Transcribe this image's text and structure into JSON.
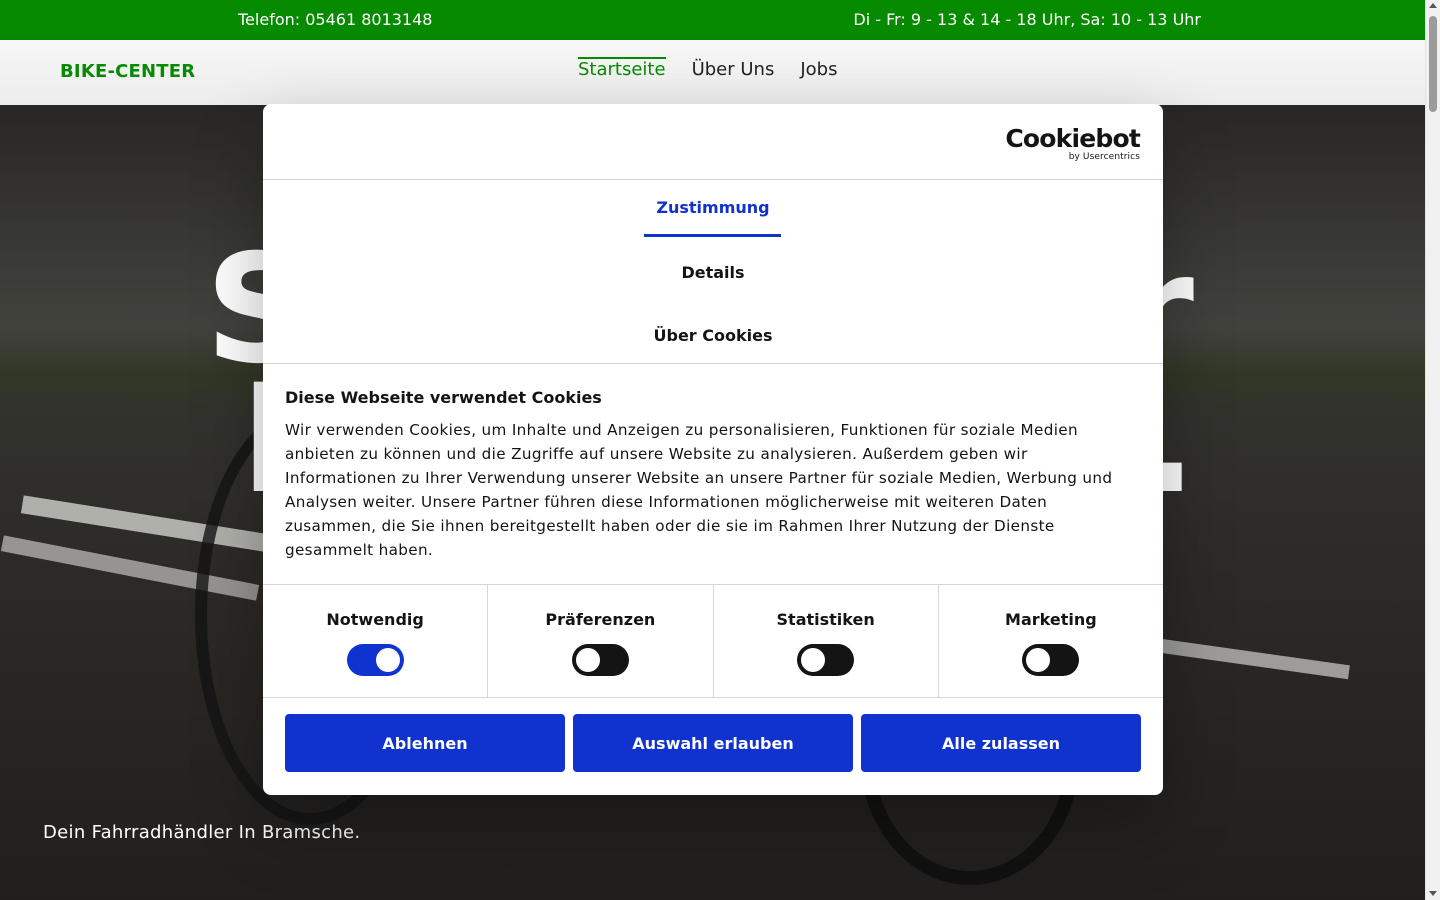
{
  "topbar": {
    "phone": "Telefon: 05461 8013148",
    "hours": "Di - Fr: 9 - 13 & 14 - 18 Uhr, Sa: 10 - 13 Uhr"
  },
  "header": {
    "logo": "BIKE-CENTER",
    "nav": [
      {
        "label": "Startseite",
        "active": true
      },
      {
        "label": "Über Uns",
        "active": false
      },
      {
        "label": "Jobs",
        "active": false
      }
    ]
  },
  "hero": {
    "big_line1_left": "S",
    "big_line1_right": "r",
    "big_line2_left": "I",
    "big_line2_right": ".",
    "tagline": "Dein Fahrradhändler In Bramsche."
  },
  "cookie_dialog": {
    "brand": "Cookiebot",
    "brand_by": "by Usercentrics",
    "tabs": [
      {
        "label": "Zustimmung",
        "active": true
      },
      {
        "label": "Details",
        "active": false
      },
      {
        "label": "Über Cookies",
        "active": false
      }
    ],
    "heading": "Diese Webseite verwendet Cookies",
    "text": "Wir verwenden Cookies, um Inhalte und Anzeigen zu personalisieren, Funktionen für soziale Medien anbieten zu können und die Zugriffe auf unsere Website zu analysieren. Außerdem geben wir Informationen zu Ihrer Verwendung unserer Website an unsere Partner für soziale Medien, Werbung und Analysen weiter. Unsere Partner führen diese Informationen möglicherweise mit weiteren Daten zusammen, die Sie ihnen bereitgestellt haben oder die sie im Rahmen Ihrer Nutzung der Dienste gesammelt haben.",
    "toggles": [
      {
        "label": "Notwendig",
        "on": true
      },
      {
        "label": "Präferenzen",
        "on": false
      },
      {
        "label": "Statistiken",
        "on": false
      },
      {
        "label": "Marketing",
        "on": false
      }
    ],
    "buttons": {
      "decline": "Ablehnen",
      "allow_selection": "Auswahl erlauben",
      "allow_all": "Alle zulassen"
    }
  },
  "colors": {
    "brand_green": "#068a00",
    "cookiebot_blue": "#1032cf"
  }
}
